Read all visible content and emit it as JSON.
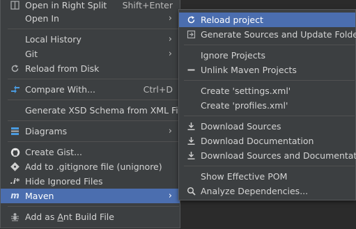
{
  "main_menu": {
    "items": [
      {
        "label": "Open in Right Split",
        "shortcut": "Shift+Enter",
        "icon": "split-icon"
      },
      {
        "label": "Open In",
        "icon": ""
      },
      {
        "label": "Local History",
        "icon": ""
      },
      {
        "label": "Git",
        "icon": ""
      },
      {
        "label": "Reload from Disk",
        "icon": "reload-icon"
      },
      {
        "label": "Compare With...",
        "shortcut": "Ctrl+D",
        "icon": "compare-icon"
      },
      {
        "label": "Generate XSD Schema from XML File...",
        "icon": ""
      },
      {
        "label": "Diagrams",
        "icon": "diagram-icon"
      },
      {
        "label": "Create Gist...",
        "icon": "github-icon"
      },
      {
        "label": "Add to .gitignore file (unignore)",
        "icon": "gitignore-icon"
      },
      {
        "label": "Hide Ignored Files",
        "icon": "ignored-files-icon"
      },
      {
        "label": "Maven",
        "icon": "maven-icon"
      },
      {
        "label": "Add as Ant Build File",
        "icon": "ant-icon"
      }
    ]
  },
  "sub_menu": {
    "items": [
      {
        "label": "Reload project",
        "icon": "reload-icon"
      },
      {
        "label": "Generate Sources and Update Folders",
        "icon": "generate-icon"
      },
      {
        "label": "Ignore Projects",
        "icon": ""
      },
      {
        "label": "Unlink Maven Projects",
        "icon": "minus-icon"
      },
      {
        "label": "Create 'settings.xml'",
        "icon": ""
      },
      {
        "label": "Create 'profiles.xml'",
        "icon": ""
      },
      {
        "label": "Download Sources",
        "icon": "download-icon"
      },
      {
        "label": "Download Documentation",
        "icon": "download-icon"
      },
      {
        "label": "Download Sources and Documentation",
        "icon": "download-icon"
      },
      {
        "label": "Show Effective POM",
        "icon": ""
      },
      {
        "label": "Analyze Dependencies...",
        "icon": "search-icon"
      }
    ]
  },
  "colors": {
    "menu_bg": "#3c3f41",
    "selection": "#4b6eaf",
    "text": "#d4d4d4",
    "separator": "#515151"
  }
}
